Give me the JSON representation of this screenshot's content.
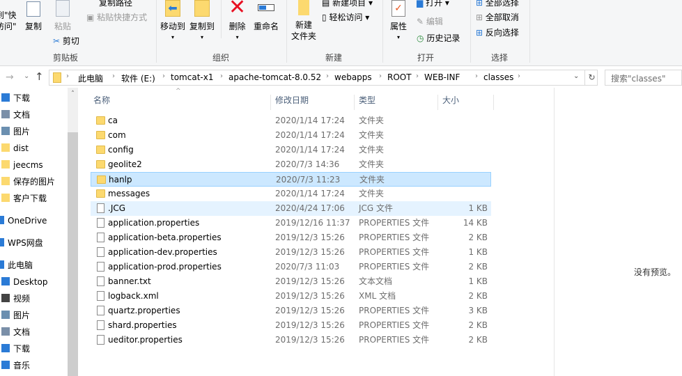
{
  "ribbon": {
    "clipboard": {
      "pin_label_1": "到\"快",
      "pin_label_2": "访问\"",
      "copy": "复制",
      "paste": "粘贴",
      "copy_path": "复制路径",
      "paste_shortcut": "粘贴快捷方式",
      "cut": "剪切",
      "group": "剪贴板"
    },
    "organize": {
      "move_to": "移动到",
      "copy_to": "复制到",
      "delete": "删除",
      "rename": "重命名",
      "group": "组织"
    },
    "new": {
      "new_folder_1": "新建",
      "new_folder_2": "文件夹",
      "new_item": "新建项目",
      "easy_access": "轻松访问",
      "group": "新建"
    },
    "open": {
      "properties": "属性",
      "open": "打开",
      "edit": "编辑",
      "history": "历史记录",
      "group": "打开"
    },
    "select": {
      "select_all": "全部选择",
      "select_none": "全部取消",
      "invert": "反向选择",
      "group": "选择"
    }
  },
  "address": {
    "crumbs": [
      "此电脑",
      "软件 (E:)",
      "tomcat-x1",
      "apache-tomcat-8.0.52",
      "webapps",
      "ROOT",
      "WEB-INF",
      "classes"
    ],
    "search_placeholder": "搜索\"classes\""
  },
  "sidebar": {
    "items": [
      "下载",
      "文档",
      "图片",
      "dist",
      "jeecms",
      "保存的图片",
      "客户下载",
      "OneDrive",
      "WPS网盘",
      "此电脑",
      "Desktop",
      "视频",
      "图片",
      "文档",
      "下载",
      "音乐"
    ]
  },
  "columns": {
    "name": "名称",
    "date": "修改日期",
    "type": "类型",
    "size": "大小"
  },
  "files": [
    {
      "name": "ca",
      "date": "2020/1/14 17:24",
      "type": "文件夹",
      "size": "",
      "kind": "folder"
    },
    {
      "name": "com",
      "date": "2020/1/14 17:24",
      "type": "文件夹",
      "size": "",
      "kind": "folder"
    },
    {
      "name": "config",
      "date": "2020/1/14 17:24",
      "type": "文件夹",
      "size": "",
      "kind": "folder"
    },
    {
      "name": "geolite2",
      "date": "2020/7/3 14:36",
      "type": "文件夹",
      "size": "",
      "kind": "folder"
    },
    {
      "name": "hanlp",
      "date": "2020/7/3 11:23",
      "type": "文件夹",
      "size": "",
      "kind": "folder"
    },
    {
      "name": "messages",
      "date": "2020/1/14 17:24",
      "type": "文件夹",
      "size": "",
      "kind": "folder"
    },
    {
      "name": ".JCG",
      "date": "2020/4/24 17:06",
      "type": "JCG 文件",
      "size": "1 KB",
      "kind": "file"
    },
    {
      "name": "application.properties",
      "date": "2019/12/16 11:37",
      "type": "PROPERTIES 文件",
      "size": "14 KB",
      "kind": "file"
    },
    {
      "name": "application-beta.properties",
      "date": "2019/12/3 15:26",
      "type": "PROPERTIES 文件",
      "size": "2 KB",
      "kind": "file"
    },
    {
      "name": "application-dev.properties",
      "date": "2019/12/3 15:26",
      "type": "PROPERTIES 文件",
      "size": "1 KB",
      "kind": "file"
    },
    {
      "name": "application-prod.properties",
      "date": "2020/7/3 11:03",
      "type": "PROPERTIES 文件",
      "size": "2 KB",
      "kind": "file"
    },
    {
      "name": "banner.txt",
      "date": "2019/12/3 15:26",
      "type": "文本文档",
      "size": "1 KB",
      "kind": "file"
    },
    {
      "name": "logback.xml",
      "date": "2019/12/3 15:26",
      "type": "XML 文档",
      "size": "2 KB",
      "kind": "file"
    },
    {
      "name": "quartz.properties",
      "date": "2019/12/3 15:26",
      "type": "PROPERTIES 文件",
      "size": "3 KB",
      "kind": "file"
    },
    {
      "name": "shard.properties",
      "date": "2019/12/3 15:26",
      "type": "PROPERTIES 文件",
      "size": "2 KB",
      "kind": "file"
    },
    {
      "name": "ueditor.properties",
      "date": "2019/12/3 15:26",
      "type": "PROPERTIES 文件",
      "size": "2 KB",
      "kind": "file"
    }
  ],
  "preview": {
    "empty": "没有预览。"
  }
}
